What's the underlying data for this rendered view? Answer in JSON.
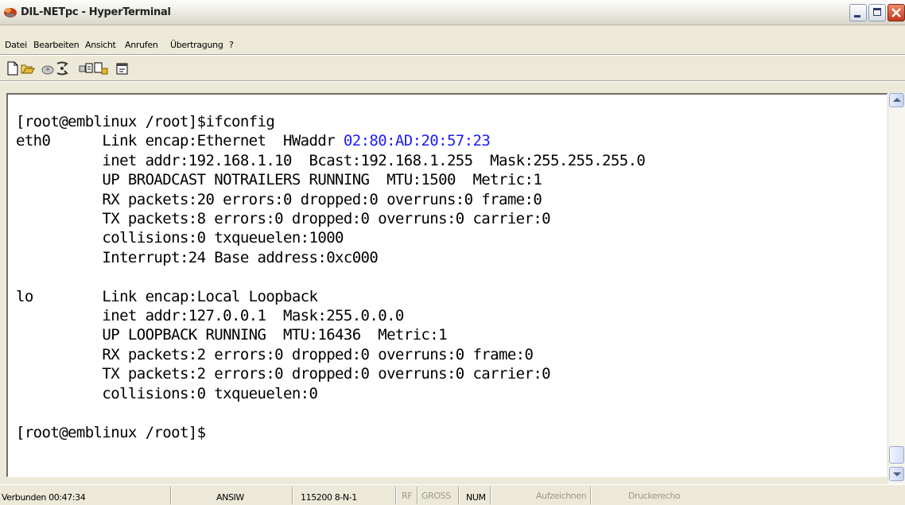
{
  "window": {
    "title": "DIL-NETpc - HyperTerminal"
  },
  "menu": [
    {
      "label": "Datei"
    },
    {
      "label": "Bearbeiten"
    },
    {
      "label": "Ansicht"
    },
    {
      "label": "Anrufen"
    },
    {
      "label": "Übertragung"
    },
    {
      "label": "?"
    }
  ],
  "toolbar": [
    "new-document-icon",
    "open-folder-icon",
    "connect-phone-icon",
    "disconnect-phone-icon",
    "send-file-icon",
    "receive-file-icon",
    "properties-icon"
  ],
  "terminal": {
    "lines": [
      "[root@emblinux /root]$ifconfig",
      "eth0      Link encap:Ethernet  HWaddr ",
      "          inet addr:192.168.1.10  Bcast:192.168.1.255  Mask:255.255.255.0",
      "          UP BROADCAST NOTRAILERS RUNNING  MTU:1500  Metric:1",
      "          RX packets:20 errors:0 dropped:0 overruns:0 frame:0",
      "          TX packets:8 errors:0 dropped:0 overruns:0 carrier:0",
      "          collisions:0 txqueuelen:1000",
      "          Interrupt:24 Base address:0xc000",
      "",
      "lo        Link encap:Local Loopback",
      "          inet addr:127.0.0.1  Mask:255.0.0.0",
      "          UP LOOPBACK RUNNING  MTU:16436  Metric:1",
      "          RX packets:2 errors:0 dropped:0 overruns:0 frame:0",
      "          TX packets:2 errors:0 dropped:0 overruns:0 carrier:0",
      "          collisions:0 txqueuelen:0",
      "",
      "[root@emblinux /root]$"
    ],
    "hwaddr": "02:80:AD:20:57:23",
    "hwaddr_color": "#1c1cff"
  },
  "status": {
    "connected": "Verbunden 00:47:34",
    "emulation": "ANSIW",
    "port_settings": "115200 8-N-1",
    "rf": "RF",
    "gross": "GROSS",
    "num": "NUM",
    "record": "Aufzeichnen",
    "print_echo": "Druckerecho"
  }
}
